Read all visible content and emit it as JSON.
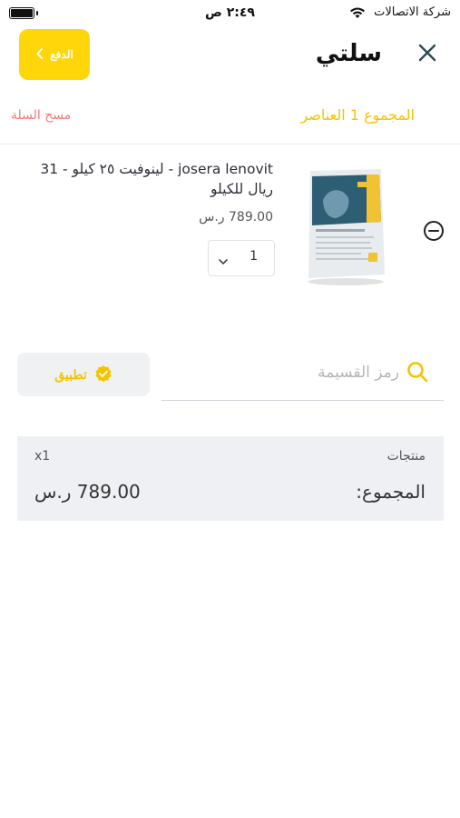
{
  "status_bar": {
    "carrier": "شركة الاتصالات",
    "time": "٢:٤٩ ص"
  },
  "header": {
    "pay_label": "الدفع",
    "title": "سلتي"
  },
  "cart": {
    "total_label": "المجموع  1 العناصر",
    "clear_label": "مسح السلة"
  },
  "product": {
    "name": "josera lenovit - لينوفيت ٢٥ كيلو - 31 ريال للكيلو",
    "price": "789.00 ر.س",
    "quantity": "1"
  },
  "coupon": {
    "placeholder": "رمز القسيمة",
    "apply_label": "تطبيق"
  },
  "summary": {
    "products_label": "منتجات",
    "count": "x1",
    "total_label": "المجموع:",
    "total_value": "789.00 ر.س"
  },
  "colors": {
    "accent": "#ffd60a",
    "accent_text": "#f5c400",
    "danger_text": "#f07a7a",
    "summary_bg": "#eef0f3"
  },
  "icons": [
    "wifi-icon",
    "battery-icon",
    "chevron-left-icon",
    "close-icon",
    "chevron-down-icon",
    "minus-circle-icon",
    "verified-badge-icon",
    "search-icon"
  ]
}
